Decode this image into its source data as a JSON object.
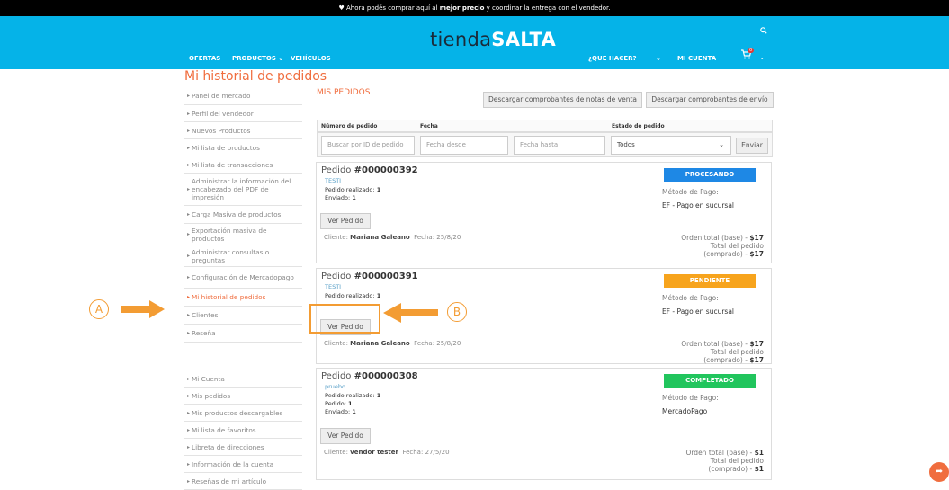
{
  "promo": {
    "prefix": "♥ Ahora podés comprar aquí al ",
    "bold": "mejor precio",
    "suffix": " y coordinar la entrega con el vendedor."
  },
  "header": {
    "logo_a": "tienda",
    "logo_b": "SALTA",
    "nav": [
      "OFERTAS",
      "PRODUCTOS ⌄",
      "VEHÍCULOS"
    ],
    "right": [
      "¿QUE HACER?",
      "⌄",
      "MI CUENTA"
    ],
    "cart_count": "0"
  },
  "page_title": "Mi historial de pedidos",
  "sidebar": {
    "items": [
      "Panel de mercado",
      "Perfil del vendedor",
      "Nuevos Productos",
      "Mi lista de productos",
      "Mi lista de transacciones",
      "Administrar la información del encabezado del PDF de impresión",
      "Carga Masiva de productos",
      "Exportación masiva de productos",
      "Administrar consultas o preguntas",
      "Configuración de Mercadopago",
      "Mi historial de pedidos",
      "Clientes",
      "Reseña"
    ],
    "items2": [
      "Mi Cuenta",
      "Mis pedidos",
      "Mis productos descargables",
      "Mi lista de favoritos",
      "Libreta de direcciones",
      "Información de la cuenta",
      "Reseñas de mi artículo"
    ]
  },
  "main": {
    "heading": "MIS PEDIDOS",
    "btn_notas": "Descargar comprobantes de notas de venta",
    "btn_envio": "Descargar comprobantes de envío",
    "col_num": "Número de pedido",
    "col_fecha": "Fecha",
    "col_estado": "Estado de pedido",
    "ph_id": "Buscar por ID de pedido",
    "ph_desde": "Fecha desde",
    "ph_hasta": "Fecha hasta",
    "estado_sel": "Todos",
    "btn_enviar": "Enviar"
  },
  "orders": [
    {
      "prefix": "Pedido ",
      "num": "#000000392",
      "store": "TESTI",
      "realizado_label": "Pedido realizado:",
      "realizado": "1",
      "pedido_label": "",
      "pedido": "",
      "enviado_label": "Enviado:",
      "enviado": "1",
      "status": "PROCESANDO",
      "status_color": "#1e88e5",
      "mp_label": "Método de Pago:",
      "mp": "EF - Pago en sucursal",
      "btn": "Ver Pedido",
      "cliente_label": "Cliente:",
      "cliente": "Mariana Galeano",
      "fecha_label": "Fecha:",
      "fecha": "25/8/20",
      "total_base_label": "Orden total (base) - ",
      "total_base": "$17",
      "total_pedido_label": "Total del pedido",
      "total_comprado_label": "(comprado) - ",
      "total_comprado": "$17"
    },
    {
      "prefix": "Pedido ",
      "num": "#000000391",
      "store": "TESTI",
      "realizado_label": "Pedido realizado:",
      "realizado": "1",
      "pedido_label": "",
      "pedido": "",
      "enviado_label": "",
      "enviado": "",
      "status": "PENDIENTE",
      "status_color": "#f7a41d",
      "mp_label": "Método de Pago:",
      "mp": "EF - Pago en sucursal",
      "btn": "Ver Pedido",
      "cliente_label": "Cliente:",
      "cliente": "Mariana Galeano",
      "fecha_label": "Fecha:",
      "fecha": "25/8/20",
      "total_base_label": "Orden total (base) - ",
      "total_base": "$17",
      "total_pedido_label": "Total del pedido",
      "total_comprado_label": "(comprado) - ",
      "total_comprado": "$17"
    },
    {
      "prefix": "Pedido ",
      "num": "#000000308",
      "store": "pruebo",
      "realizado_label": "Pedido realizado:",
      "realizado": "1",
      "pedido_label": "Pedido:",
      "pedido": "1",
      "enviado_label": "Enviado:",
      "enviado": "1",
      "status": "COMPLETADO",
      "status_color": "#21c55d",
      "mp_label": "Método de Pago:",
      "mp": "MercadoPago",
      "btn": "Ver Pedido",
      "cliente_label": "Cliente:",
      "cliente": "vendor tester",
      "fecha_label": "Fecha:",
      "fecha": "27/5/20",
      "total_base_label": "Orden total (base) - ",
      "total_base": "$1",
      "total_pedido_label": "Total del pedido",
      "total_comprado_label": "(comprado) - ",
      "total_comprado": "$1"
    }
  ],
  "annotations": {
    "a": "A",
    "b": "B"
  }
}
